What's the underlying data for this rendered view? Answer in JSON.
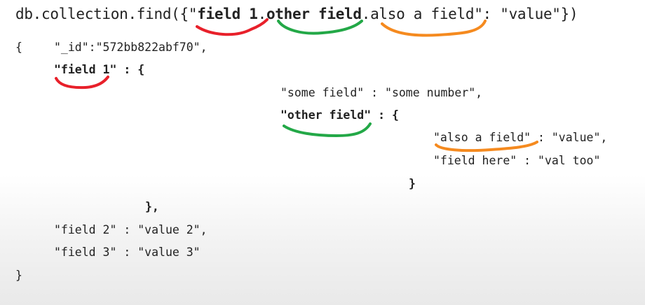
{
  "query": {
    "prefix": "db.collection.find({\"",
    "part1": "field 1",
    "dot1": ".",
    "part2": "other field",
    "dot2": ".",
    "part3": "also a field",
    "suffix": "\": \"value\"})"
  },
  "doc": {
    "open_brace": "{",
    "id_line": "\"_id\":\"572bb822abf70\",",
    "field1_key": "\"field 1\"",
    "field1_sep": " : {",
    "some_field_line": "\"some field\" : \"some number\",",
    "other_field_key": "\"other field\"",
    "other_field_sep": " : {",
    "also_field_line": "\"also a field\" : \"value\",",
    "field_here_line": "\"field here\" : \"val too\"",
    "inner_close": "}",
    "middle_close": "},",
    "field2_line": "\"field 2\" : \"value 2\",",
    "field3_line": "\"field 3\" : \"value 3\"",
    "close_brace": "}"
  },
  "colors": {
    "part1": "#e8202a",
    "part2": "#23a847",
    "part3": "#f58a1f"
  }
}
